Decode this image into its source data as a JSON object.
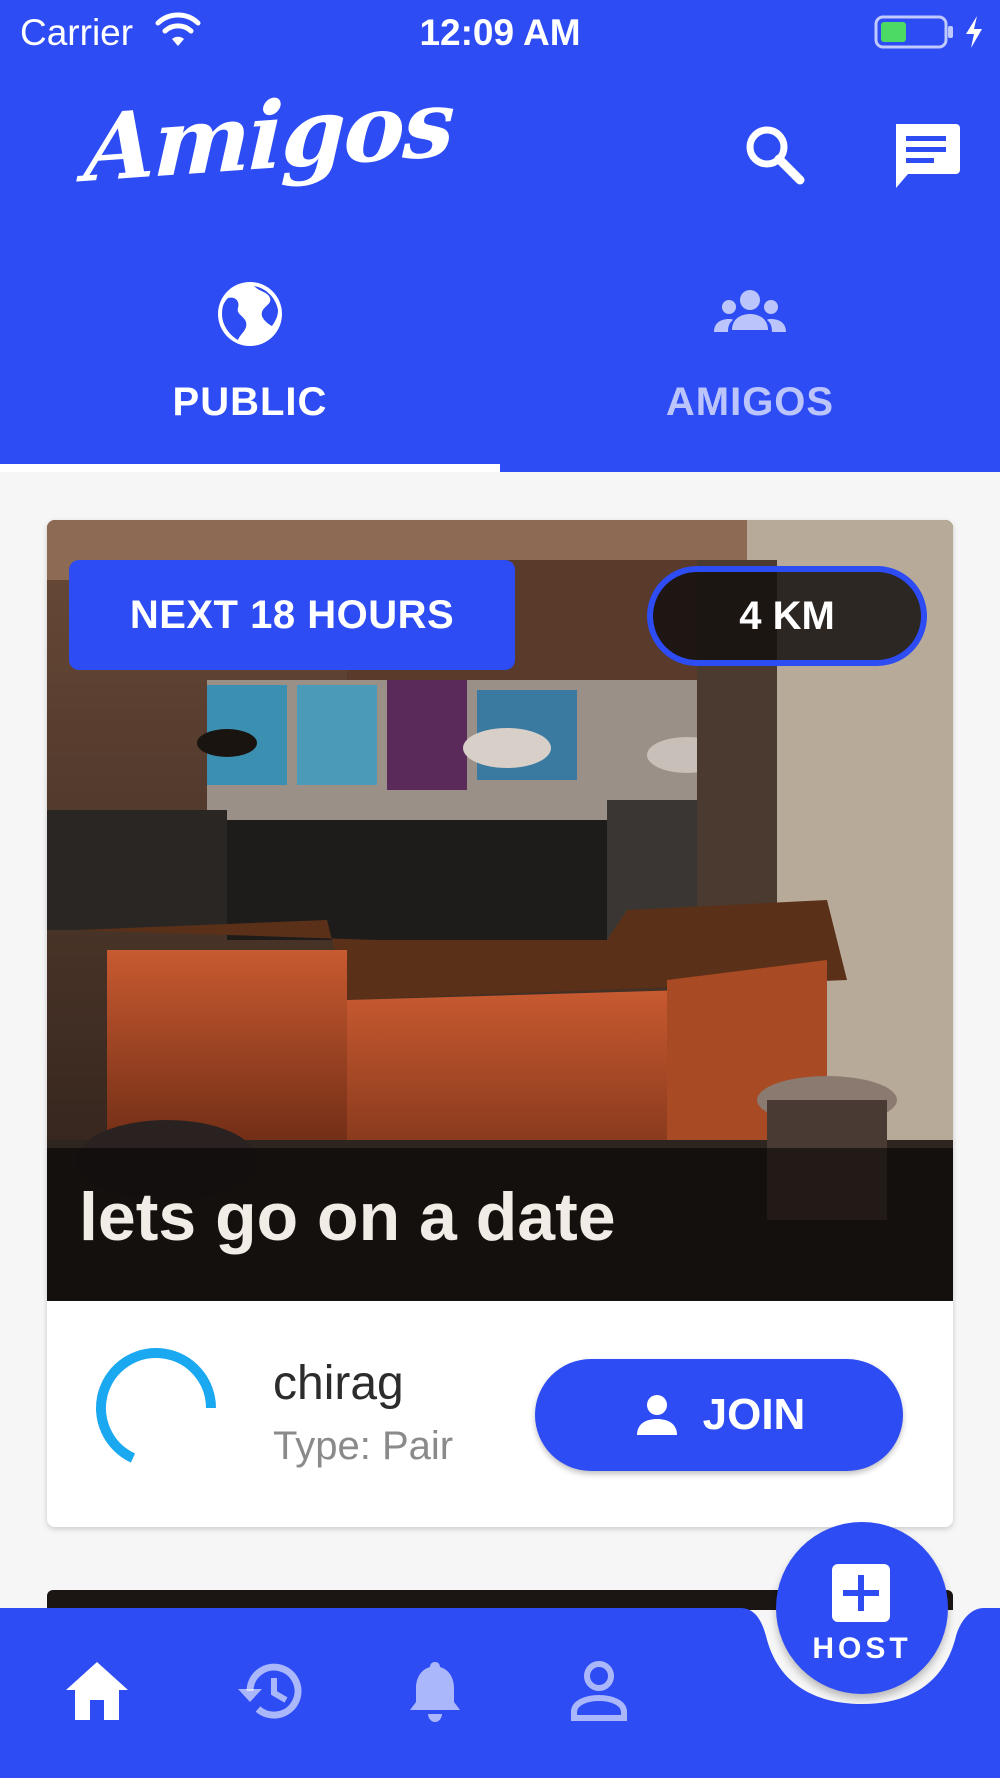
{
  "status_bar": {
    "carrier": "Carrier",
    "time": "12:09 AM",
    "battery_color": "#4cd964"
  },
  "app_bar": {
    "brand": "Amigos",
    "icons": [
      "search-icon",
      "chat-icon"
    ],
    "color": "#2d4cf4"
  },
  "tabs": [
    {
      "label": "PUBLIC",
      "icon": "globe-icon",
      "selected": true
    },
    {
      "label": "AMIGOS",
      "icon": "group-icon",
      "selected": false
    }
  ],
  "feed": {
    "cards": [
      {
        "time_badge": "NEXT 18 HOURS",
        "distance_badge": "4 KM",
        "title": "lets go on a date",
        "host_name": "chirag",
        "host_type": "Type: Pair",
        "join_label": "JOIN",
        "spinner_color": "#1aa8f0"
      }
    ]
  },
  "fab": {
    "label": "HOST",
    "icon": "plus-icon"
  },
  "bottom_nav": {
    "items": [
      {
        "name": "home",
        "icon": "home-icon",
        "active": true
      },
      {
        "name": "history",
        "icon": "history-icon",
        "active": false
      },
      {
        "name": "notifications",
        "icon": "bell-icon",
        "active": false
      },
      {
        "name": "profile",
        "icon": "person-icon",
        "active": false
      }
    ]
  }
}
